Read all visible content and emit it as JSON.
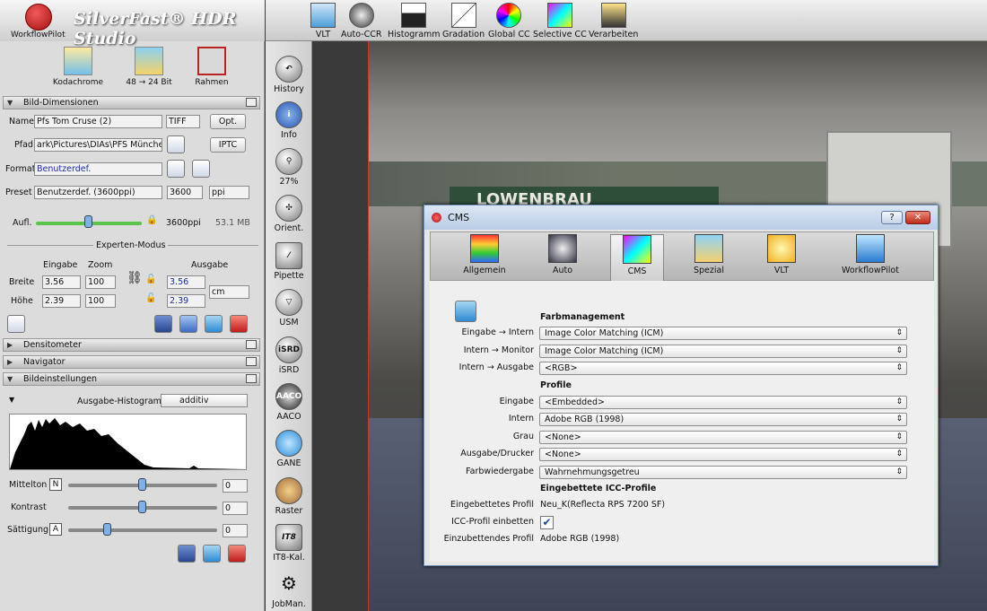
{
  "app": {
    "brand": "WorkflowPilot",
    "title": "SilverFast® HDR Studio"
  },
  "quick_tools": [
    {
      "label": "Kodachrome",
      "icon": "kodachrome-icon"
    },
    {
      "label": "48 → 24 Bit",
      "icon": "bit-conversion-icon"
    },
    {
      "label": "Rahmen",
      "icon": "frame-icon"
    }
  ],
  "sections": {
    "bild_dimensionen": "Bild-Dimensionen",
    "densitometer": "Densitometer",
    "navigator": "Navigator",
    "bildeinstellungen": "Bildeinstellungen"
  },
  "dims": {
    "name_label": "Name",
    "name_value": "Pfs Tom Cruse (2)",
    "format_type": "TIFF",
    "opt_button": "Opt.",
    "path_label": "Pfad",
    "path_value": "ark\\Pictures\\DIAs\\PFS München",
    "iptc_button": "IPTC",
    "format_label": "Format",
    "format_value": "Benutzerdef.",
    "preset_label": "Preset",
    "preset_value": "Benutzerdef. (3600ppi)",
    "ppi_value": "3600",
    "ppi_unit": "ppi",
    "resolution_label": "Aufl.",
    "resolution_value": "3600ppi",
    "file_size": "53.1 MB",
    "expert_mode": "Experten-Modus",
    "input_label": "Eingabe",
    "zoom_label": "Zoom",
    "output_label": "Ausgabe",
    "width_label": "Breite",
    "width_in": "3.56",
    "width_zoom": "100",
    "width_out": "3.56",
    "height_label": "Höhe",
    "height_in": "2.39",
    "height_zoom": "100",
    "height_out": "2.39",
    "unit": "cm"
  },
  "image_settings": {
    "histogram_label": "Ausgabe-Histogramm",
    "histogram_mode": "additiv",
    "sliders": [
      {
        "label": "Mittelton",
        "key": "N",
        "value": "0",
        "level": 0.5
      },
      {
        "label": "Kontrast",
        "key": "",
        "value": "0",
        "level": 0.5
      },
      {
        "label": "Sättigung",
        "key": "A",
        "value": "0",
        "level": 0.27
      }
    ]
  },
  "side_tools": [
    "History",
    "Info",
    "27%",
    "Orient.",
    "Pipette",
    "USM",
    "iSRD",
    "AACO",
    "GANE",
    "Raster",
    "IT8-Kal.",
    "JobMan."
  ],
  "top_tools": [
    "VLT",
    "Auto-CCR",
    "Histogramm",
    "Gradation",
    "Global CC",
    "Selective CC",
    "Verarbeiten"
  ],
  "preview": {
    "banner_text": "LOWENBRAU"
  },
  "dialog": {
    "title": "CMS",
    "help_button": "?",
    "close_button": "✕",
    "tabs": [
      "Allgemein",
      "Auto",
      "CMS",
      "Spezial",
      "VLT",
      "WorkflowPilot"
    ],
    "active_tab": "CMS",
    "heading_farb": "Farbmanagement",
    "rows_farb": [
      {
        "label": "Eingabe → Intern",
        "value": "Image Color Matching (ICM)"
      },
      {
        "label": "Intern → Monitor",
        "value": "Image Color Matching (ICM)"
      },
      {
        "label": "Intern → Ausgabe",
        "value": "<RGB>"
      }
    ],
    "heading_profile": "Profile",
    "rows_profile": [
      {
        "label": "Eingabe",
        "value": "<Embedded>"
      },
      {
        "label": "Intern",
        "value": "Adobe RGB (1998)"
      },
      {
        "label": "Grau",
        "value": "<None>"
      },
      {
        "label": "Ausgabe/Drucker",
        "value": "<None>"
      },
      {
        "label": "Farbwiedergabe",
        "value": "Wahrnehmungsgetreu"
      }
    ],
    "heading_icc": "Eingebettete ICC-Profile",
    "embedded_profile_label": "Eingebettetes Profil",
    "embedded_profile_value": "Neu_K(Reflecta RPS 7200 SF)",
    "embed_label": "ICC-Profil einbetten",
    "embed_checked": "✔",
    "to_embed_label": "Einzubettendes Profil",
    "to_embed_value": "Adobe RGB (1998)"
  }
}
